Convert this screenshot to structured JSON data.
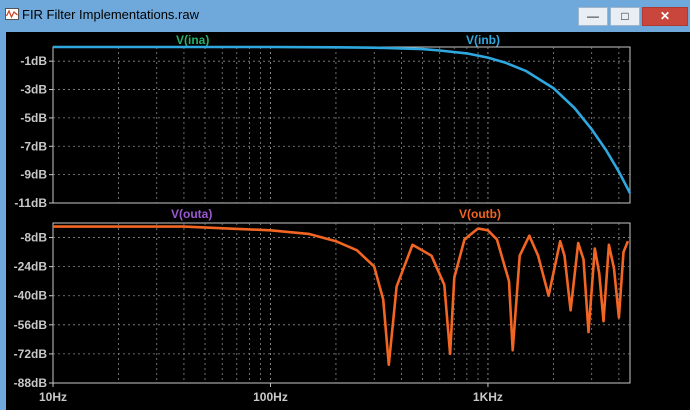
{
  "window": {
    "title": "FIR Filter Implementations.raw",
    "icon": "waveform-app-icon",
    "controls": {
      "minimize": "minimize-icon",
      "maximize": "maximize-icon",
      "close": "close-icon"
    }
  },
  "colors": {
    "frame_bg": "#6fa9dc",
    "plot_bg": "#000000",
    "grid": "#888888",
    "axis": "#c8c8c8",
    "inb": "#2fa8df",
    "outb": "#f26522",
    "ina_label": "#24b36b",
    "outa_label": "#9b59d0",
    "outb_label": "#f26522"
  },
  "chart_data": [
    {
      "type": "line",
      "xscale": "log",
      "xlim": [
        10,
        4500
      ],
      "ylim": [
        -11,
        0
      ],
      "y_ticks": [
        "-1dB",
        "-3dB",
        "-5dB",
        "-7dB",
        "-9dB",
        "-11dB"
      ],
      "y_tick_values": [
        -1,
        -3,
        -5,
        -7,
        -9,
        -11
      ],
      "grid": true,
      "series": [
        {
          "name": "V(ina)",
          "label_color": "#24b36b",
          "values": []
        },
        {
          "name": "V(inb)",
          "label_color": "#2fa8df",
          "x": [
            10,
            30,
            100,
            200,
            300,
            400,
            500,
            600,
            800,
            1000,
            1200,
            1500,
            2000,
            2500,
            3000,
            3500,
            4000,
            4500
          ],
          "values": [
            0,
            0,
            0,
            -0.02,
            -0.05,
            -0.1,
            -0.15,
            -0.25,
            -0.45,
            -0.75,
            -1.1,
            -1.7,
            -2.9,
            -4.3,
            -5.8,
            -7.3,
            -8.8,
            -10.3
          ]
        }
      ]
    },
    {
      "type": "line",
      "xscale": "log",
      "xlim": [
        10,
        4500
      ],
      "ylim": [
        -88,
        0
      ],
      "y_ticks": [
        "-8dB",
        "-24dB",
        "-40dB",
        "-56dB",
        "-72dB",
        "-88dB"
      ],
      "y_tick_values": [
        -8,
        -24,
        -40,
        -56,
        -72,
        -88
      ],
      "x_ticks": [
        "10Hz",
        "100Hz",
        "1KHz"
      ],
      "x_tick_values": [
        10,
        100,
        1000
      ],
      "grid": true,
      "series": [
        {
          "name": "V(outa)",
          "label_color": "#9b59d0",
          "values": []
        },
        {
          "name": "V(outb)",
          "label_color": "#f26522",
          "x": [
            10,
            40,
            100,
            150,
            200,
            250,
            300,
            330,
            350,
            380,
            450,
            550,
            630,
            670,
            700,
            780,
            900,
            1000,
            1100,
            1250,
            1300,
            1400,
            1550,
            1700,
            1900,
            2150,
            2250,
            2400,
            2600,
            2750,
            2900,
            3100,
            3250,
            3400,
            3600,
            3800,
            4000,
            4200,
            4400
          ],
          "values": [
            -2,
            -2,
            -4,
            -6,
            -10,
            -15,
            -24,
            -42,
            -78,
            -35,
            -12,
            -18,
            -34,
            -72,
            -30,
            -9,
            -3,
            -4,
            -9,
            -32,
            -70,
            -18,
            -7,
            -18,
            -40,
            -10,
            -18,
            -48,
            -11,
            -20,
            -60,
            -14,
            -28,
            -54,
            -12,
            -25,
            -52,
            -16,
            -10
          ]
        }
      ]
    }
  ]
}
